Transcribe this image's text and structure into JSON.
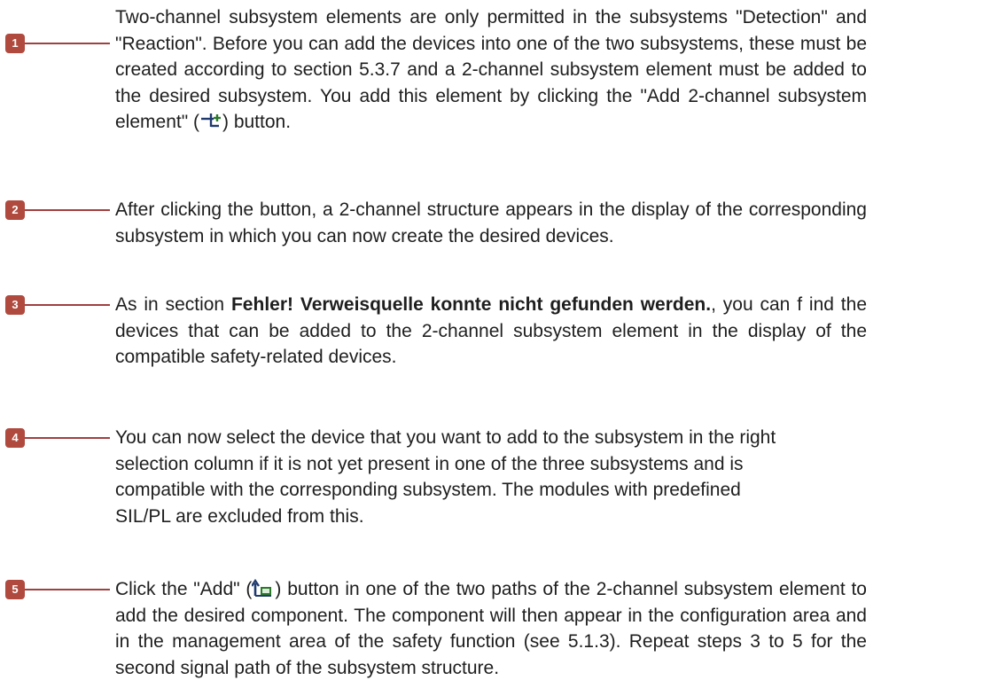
{
  "colors": {
    "badge": "#b04a3e",
    "connector": "#a04040",
    "text": "#1e1e1e"
  },
  "steps": [
    {
      "number": "1",
      "text_a": "Two-channel subsystem elements are only permitted in the subsystems \"Detection\" and \"Reaction\". Before you can add the devices into one of the two subsystems, these must be created according to section 5.3.7 and a 2-channel subsystem element must be added to the desired subsystem. You add this element by clicking the \"Add 2-channel subsystem element\" (",
      "icon": "add-2-channel-subsystem-element-icon",
      "text_b": ") button."
    },
    {
      "number": "2",
      "text": "After clicking the button, a 2-channel structure appears in the display of the corresponding subsystem in which you can now create the desired devices."
    },
    {
      "number": "3",
      "text_a": "As in section ",
      "bold": "Fehler! Verweisquelle konnte nicht gefunden werden.",
      "text_b": ", you can f ind the devices that can be added to the 2-channel subsystem element in the display of the compatible safety-related devices."
    },
    {
      "number": "4",
      "lines": [
        "You can now select the device that you want to add to the subsystem in the right",
        "selection column if it is not yet present in one of the three subsystems and is",
        "compatible with the corresponding subsystem. The modules with predefined",
        "SIL/PL are excluded from this."
      ]
    },
    {
      "number": "5",
      "text_a": "Click the \"Add\" (",
      "icon": "add-icon",
      "text_b": ") button in one of the two paths of the 2-channel subsystem element to add the desired component. The component will then appear in the configuration area and in the management area of the safety function (see 5.1.3). Repeat steps 3 to 5 for the second signal path of the subsystem structure."
    }
  ]
}
